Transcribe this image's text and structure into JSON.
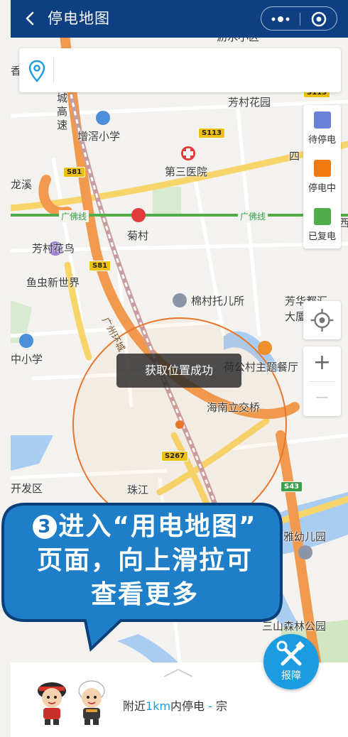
{
  "header": {
    "title": "停电地图"
  },
  "search": {
    "placeholder": ""
  },
  "legend": {
    "items": [
      {
        "label": "待停电",
        "color": "#6b82d6"
      },
      {
        "label": "停电中",
        "color": "#f07a10"
      },
      {
        "label": "已复电",
        "color": "#4fae4a"
      }
    ]
  },
  "zoom": {
    "in": "+",
    "out": "—"
  },
  "toast": "获取位置成功",
  "map_labels": {
    "top_cut": "沥水小区",
    "left_cut1": "香",
    "city_vertical": "城\n高\n速",
    "fangcun_garden": "芳村花园",
    "zengjiao_school": "增滘小学",
    "hospital": "第三医院",
    "longxi": "龙溪",
    "si": "四",
    "rail1": "广佛线",
    "rail2": "广佛线",
    "jucun": "菊村",
    "huaniao1": "芳村花鸟",
    "huaniao2": "鱼虫新世界",
    "mianc_nursery": "棉村托儿所",
    "fanghua1": "芳华都汇",
    "fanghua2": "大厦",
    "ring_road": "广州环城",
    "middle_school": "中小学",
    "restaurant": "荷公村主题餐厅",
    "hainan_bridge": "海南立交桥",
    "dev_zone": "开发区",
    "zhujiang": "珠江",
    "kindergarten": "城文雅幼儿园",
    "forest_park": "三山森林公园",
    "xi": "西"
  },
  "shields": {
    "s113a": "S113",
    "s113b": "S113",
    "s81a": "S81",
    "s81b": "S81",
    "s267": "S267",
    "s43": "S43"
  },
  "callout": {
    "step": "3",
    "line1": "进入“用电地图”",
    "line2": "页面，向上滑拉可",
    "line3": "查看更多"
  },
  "report_button": {
    "label": "报障"
  },
  "panel": {
    "nearby_prefix": "附近",
    "nearby_distance": "1km",
    "nearby_middle": "内停电",
    "nearby_count": "-",
    "nearby_unit": "宗"
  }
}
